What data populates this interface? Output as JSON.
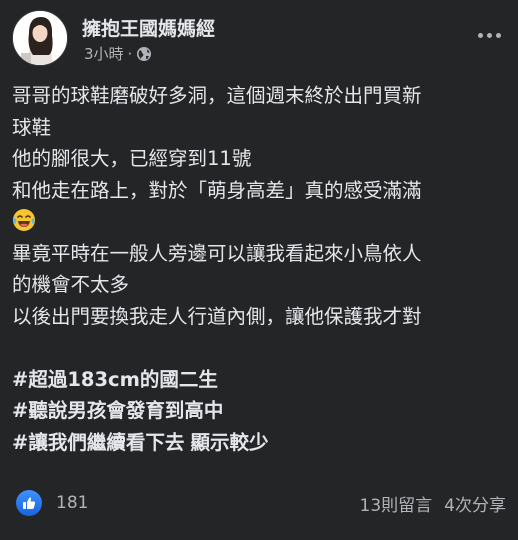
{
  "post": {
    "author": "擁抱王國媽媽經",
    "time": "3小時",
    "separator": "·",
    "privacy_icon": "globe-icon",
    "body_lines": [
      "哥哥的球鞋磨破好多洞，這個週末終於出門買新",
      "球鞋",
      "他的腳很大，已經穿到11號",
      "和他走在路上，對於「萌身高差」真的感受滿滿",
      "",
      "畢竟平時在一般人旁邊可以讓我看起來小鳥依人",
      "的機會不太多",
      "以後出門要換我走人行道內側，讓他保護我才對"
    ],
    "emoji": "laughing-tears-emoji",
    "hashtags": [
      "#超過183cm的國二生",
      "#聽說男孩會發育到高中",
      "#讓我們繼續看下去"
    ],
    "see_less": "顯示較少"
  },
  "footer": {
    "reaction_icon": "like-icon",
    "reaction_count": "181",
    "comments": "13則留言",
    "shares": "4次分享"
  },
  "colors": {
    "background": "#242526",
    "text": "#e4e6eb",
    "secondary_text": "#b0b3b8",
    "like_blue": "#1877f2"
  }
}
